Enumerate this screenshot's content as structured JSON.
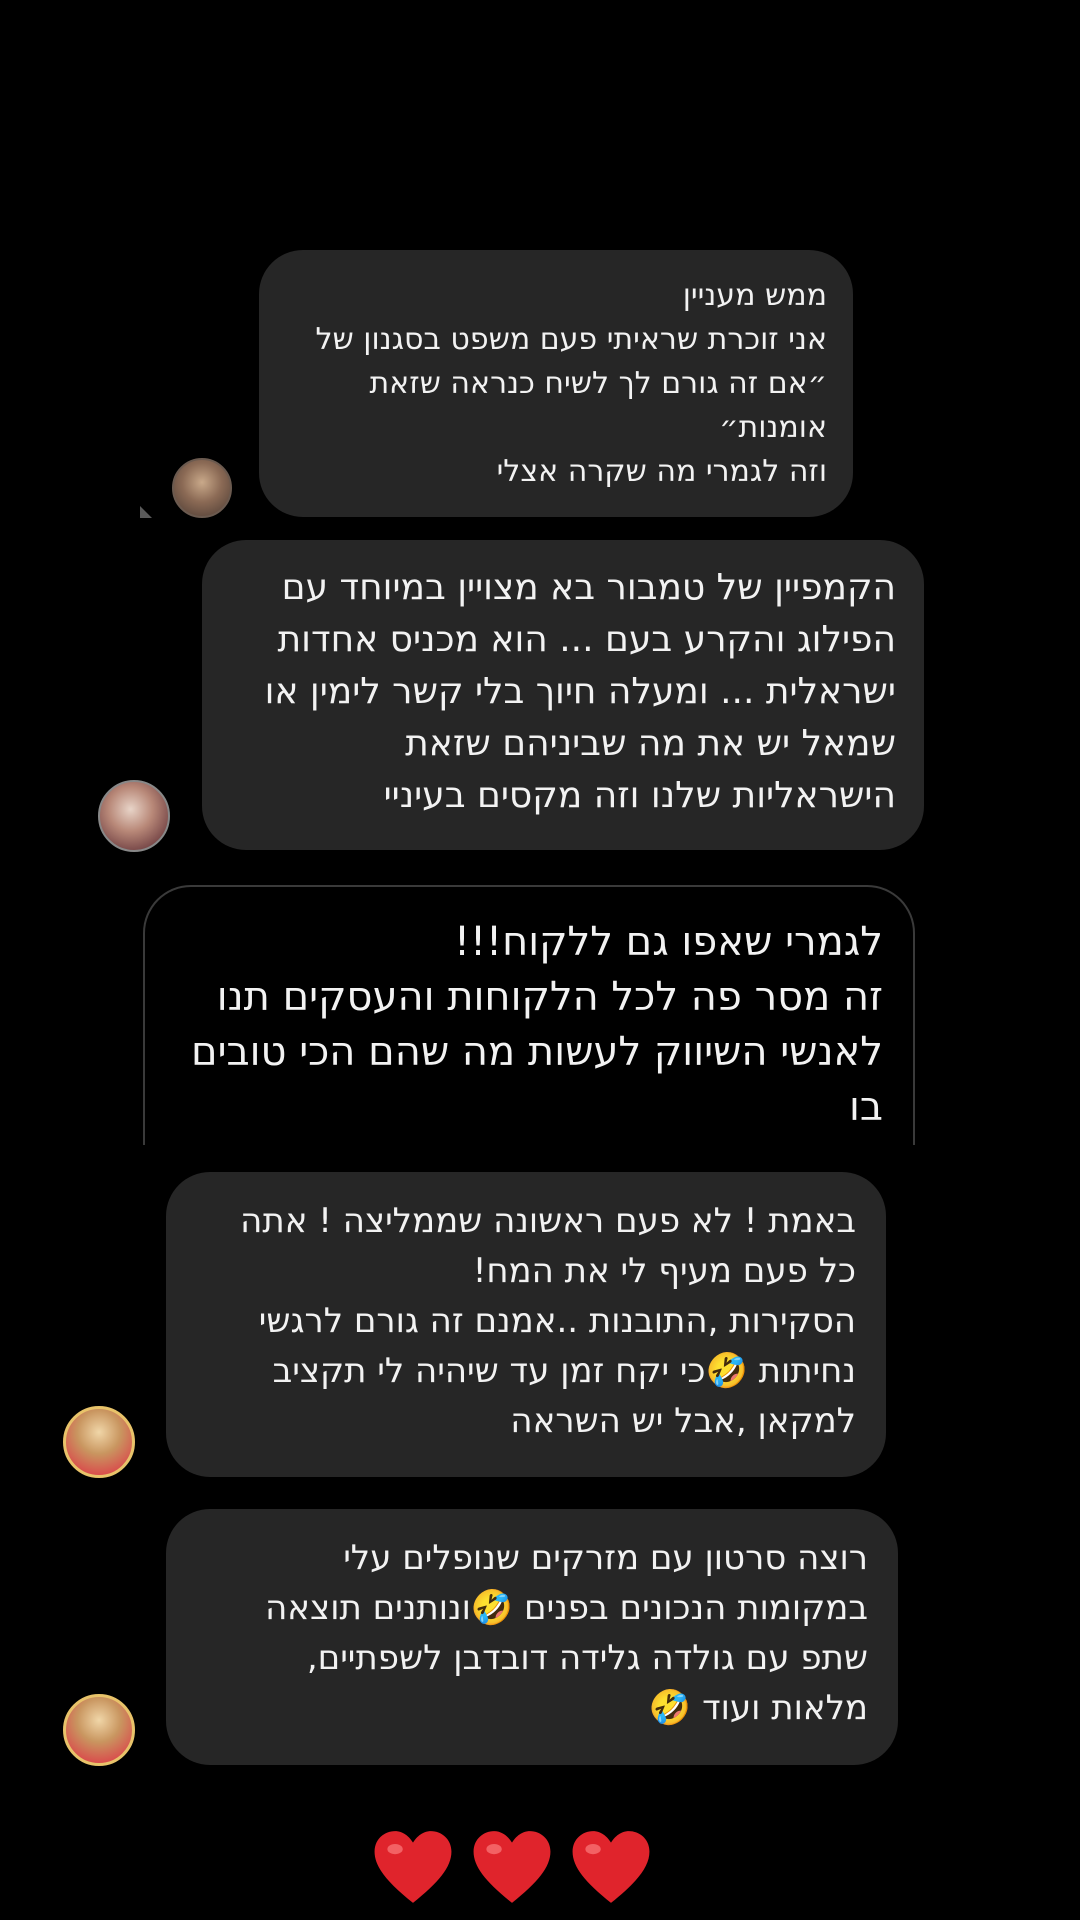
{
  "messages": [
    {
      "lines": [
        "ממש מעניין",
        "אני זוכרת שראיתי פעם משפט בסגנון של",
        "״אם זה גורם לך לשיח כנראה שזאת",
        "אומנות״",
        "וזה לגמרי מה שקרה אצלי"
      ]
    },
    {
      "lines": [
        "הקמפיין של טמבור בא מצויין במיוחד עם",
        "הפילוג והקרע בעם ... הוא מכניס אחדות",
        "ישראלית ... ומעלה חיוך בלי קשר לימין או",
        "שמאל יש את מה שביניהם שזאת",
        "הישראליות שלנו וזה מקסים בעיניי"
      ]
    },
    {
      "lines": [
        "לגמרי שאפו גם ללקוח!!!",
        "זה מסר פה לכל הלקוחות והעסקים תנו",
        "לאנשי השיווק לעשות מה שהם הכי טובים",
        "בו"
      ]
    },
    {
      "lines": [
        "באמת ! לא פעם ראשונה שממליצה ! אתה",
        "כל פעם מעיף לי את המח!",
        "הסקירות ,התובנות ..אמנם זה גורם לרגשי",
        "נחיתות 🤣כי יקח זמן עד שיהיה לי תקציב",
        "למקאן ,אבל יש השראה"
      ]
    },
    {
      "lines": [
        "רוצה סרטון עם מזרקים שנופלים עלי",
        "במקומות הנכונים בפנים 🤣ונותנים תוצאה",
        "שתפ עם גולדה גלידה דובדבן  לשפתיים,",
        "מלאות ועוד 🤣"
      ]
    }
  ],
  "reactions": {
    "hearts": [
      "❤",
      "❤",
      "❤"
    ],
    "heart_color": "#e0242c"
  },
  "colors": {
    "background": "#000000",
    "bubble": "#262626",
    "text": "#f2f2f2"
  }
}
